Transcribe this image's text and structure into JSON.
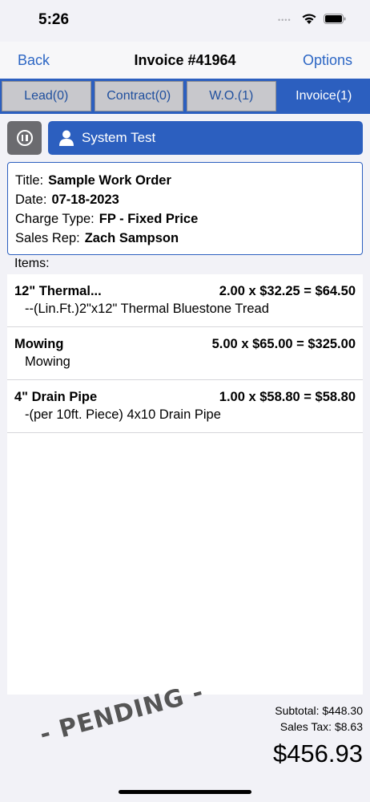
{
  "status": {
    "time": "5:26",
    "dots": "••••"
  },
  "nav": {
    "back": "Back",
    "title": "Invoice #41964",
    "options": "Options"
  },
  "tabs": [
    {
      "label": "Lead(0)",
      "active": false
    },
    {
      "label": "Contract(0)",
      "active": false
    },
    {
      "label": "W.O.(1)",
      "active": false
    },
    {
      "label": "Invoice(1)",
      "active": true
    }
  ],
  "user": {
    "name": "System Test"
  },
  "info": {
    "title_label": "Title:",
    "title_value": "Sample Work Order",
    "date_label": "Date:",
    "date_value": "07-18-2023",
    "charge_label": "Charge Type:",
    "charge_value": "FP - Fixed Price",
    "rep_label": "Sales Rep:",
    "rep_value": "Zach Sampson"
  },
  "items_label": "Items:",
  "items": [
    {
      "name": "12\" Thermal...",
      "calc": "2.00 x $32.25 = $64.50",
      "desc": "--(Lin.Ft.)2\"x12\" Thermal Bluestone Tread"
    },
    {
      "name": "Mowing",
      "calc": "5.00 x $65.00 = $325.00",
      "desc": "Mowing"
    },
    {
      "name": "4\" Drain Pipe",
      "calc": "1.00 x $58.80 = $58.80",
      "desc": "-(per 10ft. Piece) 4x10 Drain Pipe"
    }
  ],
  "totals": {
    "subtotal": "Subtotal:  $448.30",
    "tax": "Sales Tax:  $8.63",
    "grand": "$456.93"
  },
  "pending": "- PENDING -",
  "colors": {
    "accent": "#2c5fbf",
    "link": "#2c66c4",
    "background": "#f2f2f7"
  }
}
